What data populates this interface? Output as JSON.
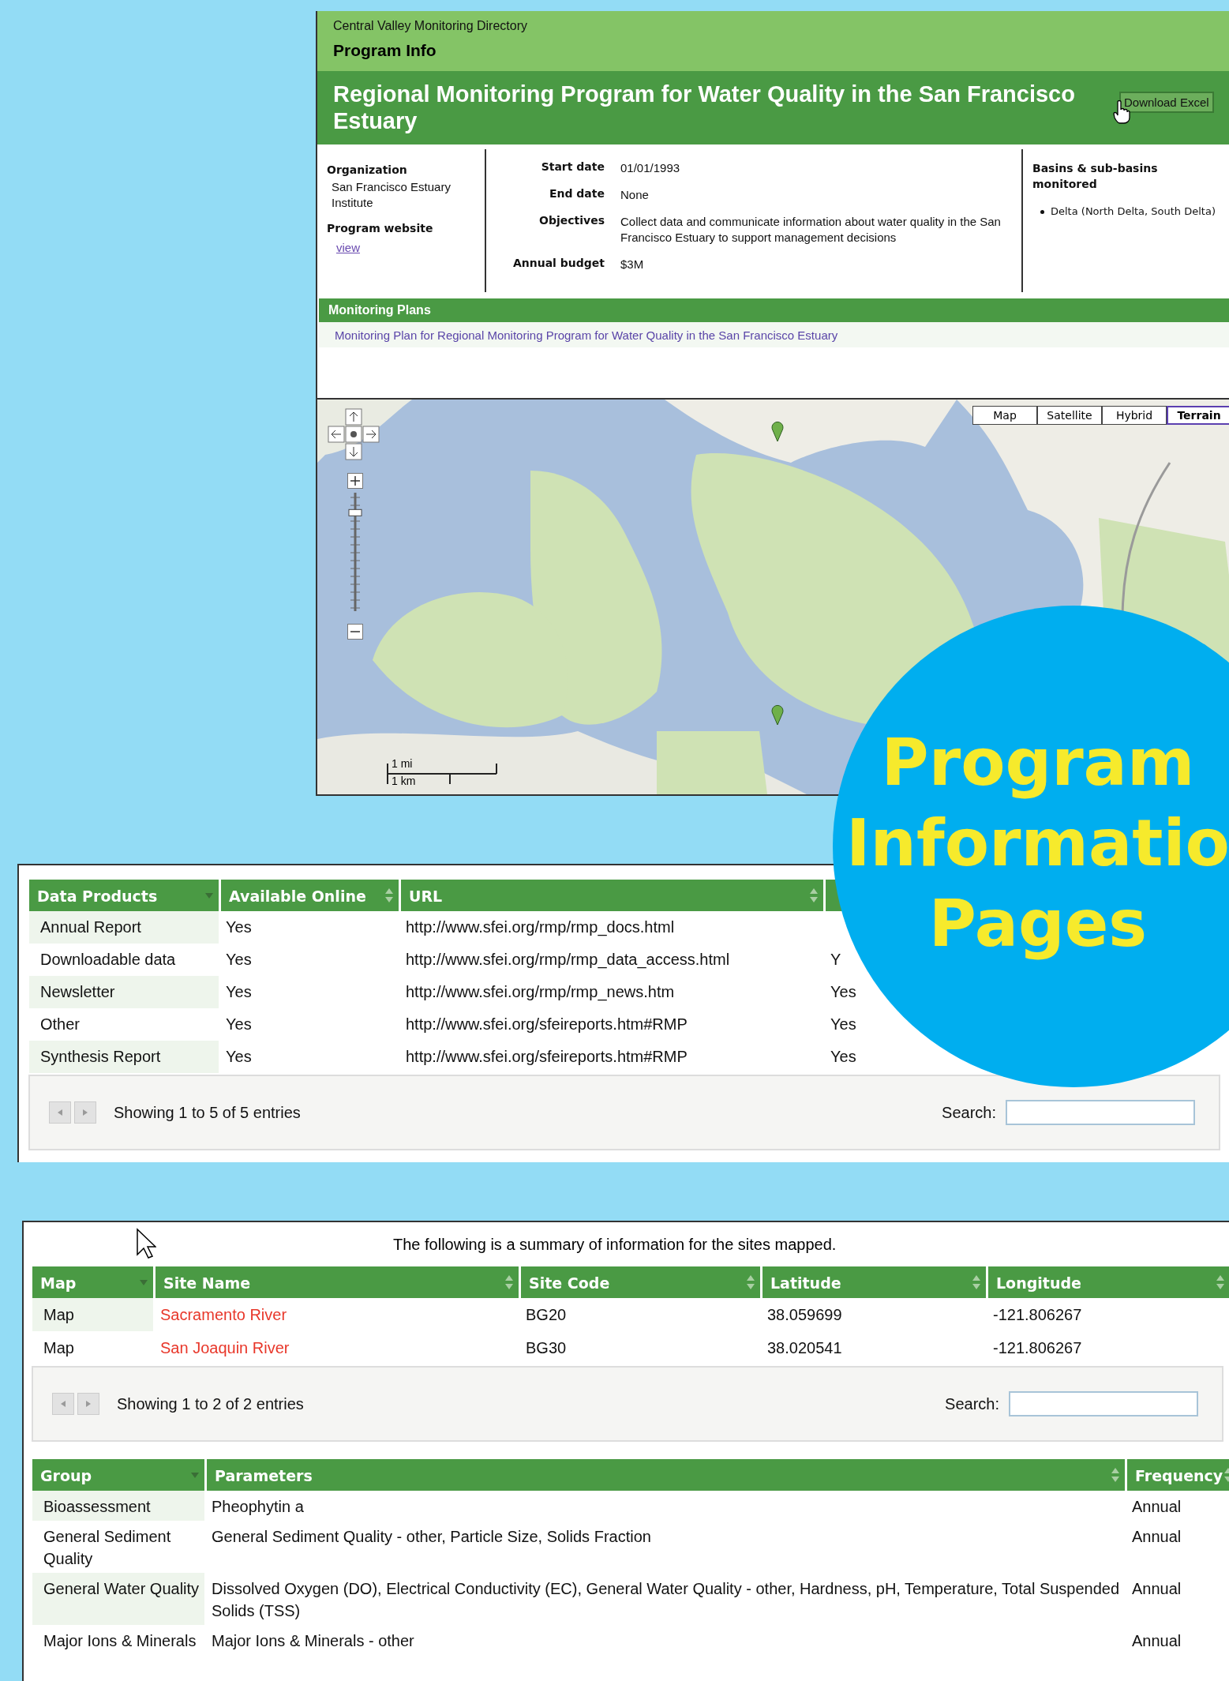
{
  "program_panel": {
    "directory": "Central Valley Monitoring Directory",
    "page_title": "Program Info",
    "program_name": "Regional Monitoring Program for Water Quality in the San Francisco Estuary",
    "download_button": "Download Excel",
    "organization_label": "Organization",
    "organization": "San Francisco Estuary Institute",
    "website_label": "Program website",
    "website_link": "view",
    "details": [
      {
        "label": "Start date",
        "value": "01/01/1993"
      },
      {
        "label": "End date",
        "value": "None"
      },
      {
        "label": "Objectives",
        "value": "Collect data and communicate information about water quality in the San Francisco Estuary to support management decisions"
      },
      {
        "label": "Annual budget",
        "value": "$3M"
      }
    ],
    "basins_label": "Basins & sub-basins monitored",
    "basins": [
      "Delta (North Delta, South Delta)"
    ],
    "plans_heading": "Monitoring Plans",
    "plans": [
      "Monitoring Plan for Regional Monitoring Program for Water Quality in the San Francisco Estuary"
    ]
  },
  "map": {
    "map_types": [
      {
        "label": "Map",
        "selected": false
      },
      {
        "label": "Satellite",
        "selected": false
      },
      {
        "label": "Hybrid",
        "selected": false
      },
      {
        "label": "Terrain",
        "selected": true
      }
    ],
    "scale": [
      "1 mi",
      "1 km"
    ],
    "zoom_slider": {
      "level": 0.85
    }
  },
  "data_products": {
    "columns": [
      {
        "label": "Data Products",
        "sorted": true
      },
      {
        "label": "Available Online",
        "sorted": false
      },
      {
        "label": "URL",
        "sorted": false
      }
    ],
    "rows": [
      [
        "Annual Report",
        "Yes",
        "http://www.sfei.org/rmp/rmp_docs.html"
      ],
      [
        "Downloadable data",
        "Yes",
        "http://www.sfei.org/rmp/rmp_data_access.html",
        "Y"
      ],
      [
        "Newsletter",
        "Yes",
        "http://www.sfei.org/rmp/rmp_news.htm",
        "Yes"
      ],
      [
        "Other",
        "Yes",
        "http://www.sfei.org/sfeireports.htm#RMP",
        "Yes"
      ],
      [
        "Synthesis Report",
        "Yes",
        "http://www.sfei.org/sfeireports.htm#RMP",
        "Yes"
      ]
    ],
    "info": "Showing 1 to 5 of 5 entries",
    "search_label": "Search:"
  },
  "banner": {
    "lines": [
      "Program",
      "Informatio",
      "Pages"
    ]
  },
  "sites": {
    "summary": "The following is a summary of information for the sites mapped.",
    "columns": [
      {
        "label": "Map",
        "sorted": true
      },
      {
        "label": "Site Name",
        "sorted": false
      },
      {
        "label": "Site Code",
        "sorted": false
      },
      {
        "label": "Latitude",
        "sorted": false
      },
      {
        "label": "Longitude",
        "sorted": false
      }
    ],
    "rows": [
      [
        "Map",
        "Sacramento River",
        "BG20",
        "38.059699",
        "-121.806267"
      ],
      [
        "Map",
        "San Joaquin River",
        "BG30",
        "38.020541",
        "-121.806267"
      ]
    ],
    "info": "Showing 1 to 2 of 2 entries",
    "search_label": "Search:"
  },
  "parameters": {
    "columns": [
      {
        "label": "Group",
        "sorted": true
      },
      {
        "label": "Parameters",
        "sorted": false
      },
      {
        "label": "Frequency",
        "sorted": false
      }
    ],
    "rows": [
      [
        "Bioassessment",
        "Pheophytin a",
        "Annual"
      ],
      [
        "General Sediment Quality",
        "General Sediment Quality - other, Particle Size, Solids Fraction",
        "Annual"
      ],
      [
        "General Water Quality",
        "Dissolved Oxygen (DO), Electrical Conductivity (EC), General Water Quality - other, Hardness, pH, Temperature, Total Suspended Solids (TSS)",
        "Annual"
      ],
      [
        "Major Ions & Minerals",
        "Major Ions & Minerals - other",
        "Annual"
      ]
    ]
  }
}
